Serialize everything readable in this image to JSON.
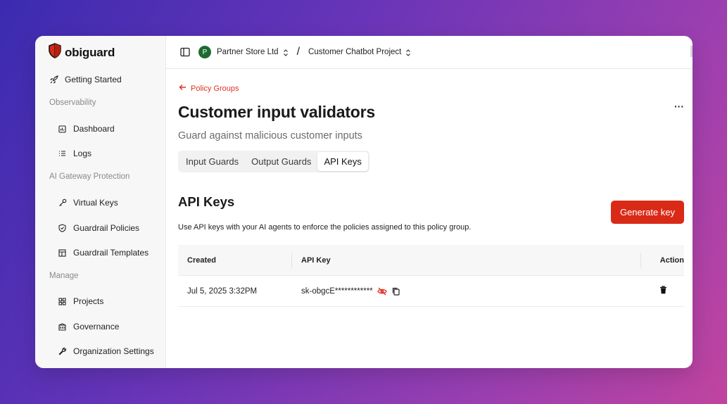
{
  "brand": {
    "name_part1": "obi",
    "name_part2": "guard"
  },
  "sidebar": {
    "getting_started": "Getting Started",
    "sections": {
      "observability": "Observability",
      "gateway": "AI Gateway Protection",
      "manage": "Manage"
    },
    "items": {
      "dashboard": "Dashboard",
      "logs": "Logs",
      "virtual_keys": "Virtual Keys",
      "guardrail_policies": "Guardrail Policies",
      "guardrail_templates": "Guardrail Templates",
      "projects": "Projects",
      "governance": "Governance",
      "organization_settings": "Organization Settings"
    }
  },
  "topbar": {
    "org_initial": "P",
    "org_name": "Partner Store Ltd",
    "separator": "/",
    "project_name": "Customer Chatbot Project"
  },
  "page": {
    "back_label": "Policy Groups",
    "title": "Customer input validators",
    "subtitle": "Guard against malicious customer inputs",
    "more": "···",
    "tabs": [
      "Input Guards",
      "Output Guards",
      "API Keys"
    ],
    "active_tab": "API Keys"
  },
  "api_keys": {
    "title": "API Keys",
    "generate_label": "Generate key",
    "description": "Use API keys with your AI agents to enforce the policies assigned to this policy group.",
    "columns": {
      "created": "Created",
      "api_key": "API Key",
      "action": "Action"
    },
    "rows": [
      {
        "created": "Jul 5, 2025 3:32PM",
        "key": "sk-obgcE************"
      }
    ]
  },
  "colors": {
    "accent": "#d92a17",
    "org_avatar": "#1e6b2f",
    "link": "#e0311f"
  },
  "icons": {
    "back": "arrow-left-icon",
    "panel": "sidebar-toggle-icon",
    "reveal": "eye-off-icon",
    "copy": "copy-icon",
    "delete": "trash-icon"
  }
}
